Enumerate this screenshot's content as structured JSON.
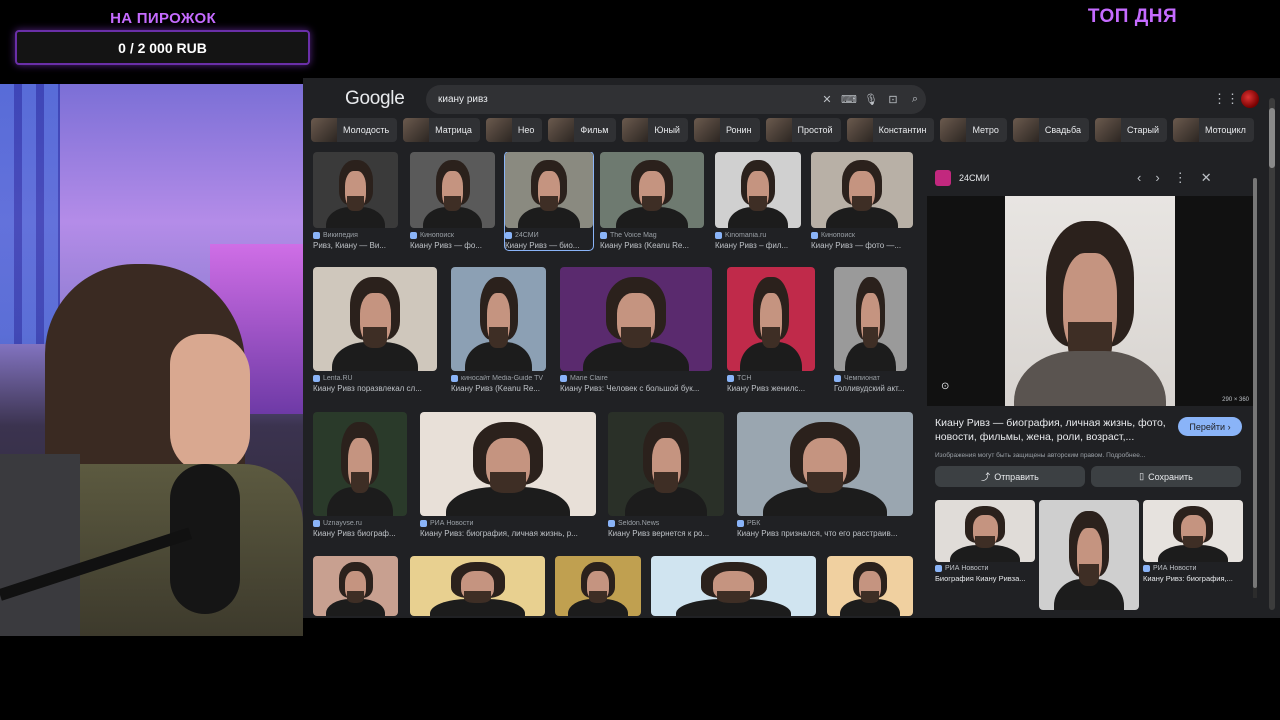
{
  "overlay": {
    "donation_title": "НА ПИРОЖОК",
    "donation_progress": "0 / 2 000 RUB",
    "top_label": "ТОП ДНЯ"
  },
  "google": {
    "logo": "Google",
    "query": "киану ривз",
    "icons": [
      "clear-icon",
      "keyboard-icon",
      "mic-icon",
      "lens-icon",
      "search-icon",
      "apps-icon"
    ]
  },
  "chips": [
    "Молодость",
    "Матрица",
    "Нео",
    "Фильм",
    "Юный",
    "Ронин",
    "Простой",
    "Константин",
    "Метро",
    "Свадьба",
    "Старый",
    "Мотоцикл"
  ],
  "results": [
    {
      "source": "Википедия",
      "caption": "Ривз, Киану — Ви..."
    },
    {
      "source": "Кинопоиск",
      "caption": "Киану Ривз — фо..."
    },
    {
      "source": "24СМИ",
      "caption": "Киану Ривз — био..."
    },
    {
      "source": "The Voice Mag",
      "caption": "Киану Ривз (Keanu Re..."
    },
    {
      "source": "Kinomania.ru",
      "caption": "Киану Ривз – фил..."
    },
    {
      "source": "Кинопоиск",
      "caption": "Киану Ривз — фото —..."
    },
    {
      "source": "Lenta.RU",
      "caption": "Киану Ривз поразвлекал сл..."
    },
    {
      "source": "киносайт Media-Guide TV",
      "caption": "Киану Ривз (Keanu Re..."
    },
    {
      "source": "Marie Claire",
      "caption": "Киану Ривз: Человек с большой бук..."
    },
    {
      "source": "ТСН",
      "caption": "Киану Ривз женилс..."
    },
    {
      "source": "Чемпионат",
      "caption": "Голливудский акт..."
    },
    {
      "source": "Uznayvse.ru",
      "caption": "Киану Ривз биограф..."
    },
    {
      "source": "РИА Новости",
      "caption": "Киану Ривз: биография, личная жизнь, р..."
    },
    {
      "source": "Seldon.News",
      "caption": "Киану Ривз вернется к ро..."
    },
    {
      "source": "РБК",
      "caption": "Киану Ривз признался, что его расстраив..."
    },
    {
      "source": "",
      "caption": ""
    },
    {
      "source": "",
      "caption": ""
    },
    {
      "source": "",
      "caption": ""
    },
    {
      "source": "",
      "caption": ""
    },
    {
      "source": "",
      "caption": ""
    }
  ],
  "panel": {
    "source": "24СМИ",
    "dimensions": "290 × 360",
    "title": "Киану Ривз — биография, личная жизнь, фото, новости, фильмы, жена, роли, возраст,...",
    "visit_label": "Перейти",
    "copyright": "Изображения могут быть защищены авторским правом. Подробнее...",
    "share_label": "Отправить",
    "save_label": "Сохранить",
    "related": [
      {
        "source": "РИА Новости",
        "caption": "Биография Киану Ривза..."
      },
      {
        "source": "",
        "caption": ""
      },
      {
        "source": "РИА Новости",
        "caption": "Киану Ривз: биография,..."
      }
    ]
  },
  "colors": {
    "overlay_accent": "#c56bff",
    "google_bg": "#202124",
    "link_blue": "#8ab4f8"
  }
}
